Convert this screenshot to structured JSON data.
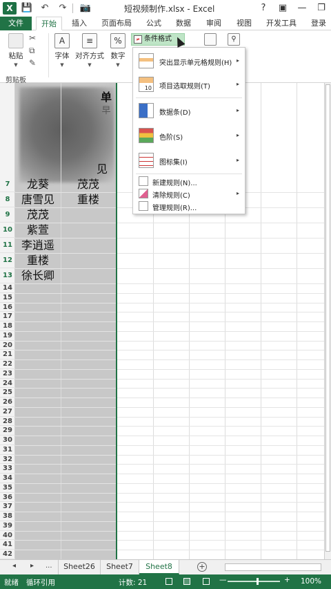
{
  "titlebar": {
    "app_logo": "X",
    "title": "短视频制作.xlsx - Excel",
    "help": "?",
    "ribbon_opts": "▣",
    "minimize": "—",
    "restore": "❐"
  },
  "quick_access": {
    "save_icon": "💾",
    "undo_icon": "↶",
    "redo_icon": "↷",
    "camera_icon": "📷"
  },
  "tabs": [
    "文件",
    "开始",
    "插入",
    "页面布局",
    "公式",
    "数据",
    "审阅",
    "视图",
    "开发工具",
    "登录"
  ],
  "ribbon": {
    "paste_label": "粘贴",
    "clipboard_group": "剪贴板",
    "font_label": "字体",
    "align_label": "对齐方式",
    "number_label": "数字",
    "font_icon": "A",
    "align_icon": "≡",
    "number_icon": "%",
    "conditional_format": "条件格式",
    "cond_icon_text": "≠"
  },
  "conditional_menu": {
    "items": [
      {
        "label": "突出显示单元格规则(H)",
        "has_submenu": true,
        "icon": "highlight-rules-icon"
      },
      {
        "label": "项目选取规则(T)",
        "has_submenu": true,
        "icon": "top-bottom-icon"
      },
      {
        "label": "数据条(D)",
        "has_submenu": true,
        "icon": "data-bars-icon"
      },
      {
        "label": "色阶(S)",
        "has_submenu": true,
        "icon": "color-scales-icon"
      },
      {
        "label": "图标集(I)",
        "has_submenu": true,
        "icon": "icon-sets-icon"
      }
    ],
    "small_items": [
      {
        "label": "新建规则(N)...",
        "has_submenu": false
      },
      {
        "label": "清除规则(C)",
        "has_submenu": true
      },
      {
        "label": "管理规则(R)..."
      }
    ],
    "submenu_arrow": "▸",
    "top_bottom_icon_text": "10"
  },
  "grid": {
    "visible_header_text": "单",
    "header_row_partial": "早",
    "row6_partial": "见",
    "rows": [
      {
        "num": "7",
        "a": "龙葵",
        "b": "茂茂"
      },
      {
        "num": "8",
        "a": "唐雪见",
        "b": "重楼"
      },
      {
        "num": "9",
        "a": "茂茂",
        "b": ""
      },
      {
        "num": "10",
        "a": "紫萱",
        "b": ""
      },
      {
        "num": "11",
        "a": "李逍遥",
        "b": ""
      },
      {
        "num": "12",
        "a": "重楼",
        "b": ""
      },
      {
        "num": "13",
        "a": "徐长卿",
        "b": ""
      }
    ],
    "empty_row_numbers": [
      "14",
      "15",
      "16",
      "17",
      "18",
      "19",
      "20",
      "21",
      "22",
      "23",
      "24",
      "25",
      "26",
      "27",
      "28",
      "29",
      "30",
      "31",
      "32",
      "33",
      "34",
      "35",
      "36",
      "37",
      "38",
      "39",
      "40",
      "41",
      "42"
    ]
  },
  "sheets": {
    "nav_left": "◂",
    "nav_right": "▸",
    "ellipsis": "...",
    "tabs": [
      "Sheet26",
      "Sheet7",
      "Sheet8"
    ],
    "active": "Sheet8",
    "add": "+"
  },
  "status": {
    "ready": "就绪",
    "circular": "循环引用",
    "count": "计数: 21",
    "zoom_minus": "—",
    "zoom_plus": "+",
    "zoom": "100%"
  }
}
